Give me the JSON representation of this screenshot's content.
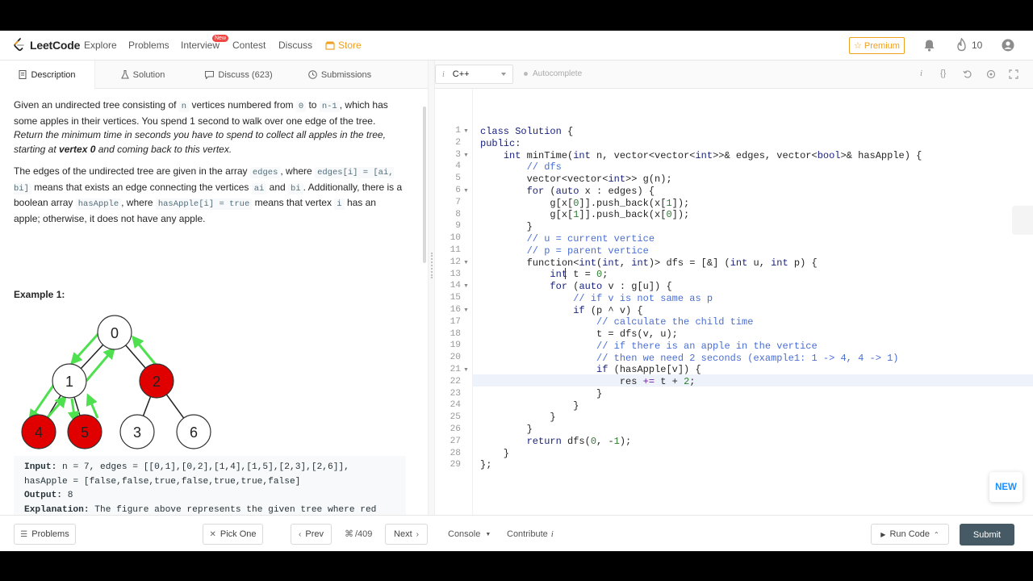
{
  "nav": {
    "logo": "LeetCode",
    "items": [
      "Explore",
      "Problems",
      "Interview",
      "Contest",
      "Discuss",
      "Store"
    ],
    "interview_badge": "New",
    "premium": "Premium",
    "fire_count": "10"
  },
  "tabs": {
    "description": "Description",
    "solution": "Solution",
    "discuss": "Discuss (623)",
    "submissions": "Submissions"
  },
  "description": {
    "p1_a": "Given an undirected tree consisting of ",
    "p1_n": "n",
    "p1_b": " vertices numbered from ",
    "p1_zero": "0",
    "p1_to": " to ",
    "p1_n1": "n-1",
    "p1_c": ", which has some apples in their vertices. You spend 1 second to walk over one edge of the tree. ",
    "p1_italic_a": "Return the minimum time in seconds you have to spend to collect all apples in the tree, starting at ",
    "p1_bold": "vertex 0",
    "p1_italic_b": " and coming back to this vertex.",
    "p2_a": "The edges of the undirected tree are given in the array ",
    "p2_edges": "edges",
    "p2_b": ", where ",
    "p2_edgesi": "edges[i] = [ai, bi]",
    "p2_c": " means that exists an edge connecting the vertices ",
    "p2_ai": "ai",
    "p2_and": " and ",
    "p2_bi": "bi",
    "p2_d": ". Additionally, there is a boolean array ",
    "p2_hasApple": "hasApple",
    "p2_e": ", where ",
    "p2_hasAppleTrue": "hasApple[i] = true",
    "p2_f": " means that vertex ",
    "p2_i": "i",
    "p2_g": " has an apple; otherwise, it does not have any apple.",
    "example_title": "Example 1:",
    "tree_labels": [
      "0",
      "1",
      "2",
      "4",
      "5",
      "3",
      "6"
    ],
    "input_label": "Input:",
    "input_text": " n = 7, edges = [[0,1],[0,2],[1,4],[1,5],[2,3],[2,6]], hasApple = [false,false,true,false,true,true,false]",
    "output_label": "Output:",
    "output_text": " 8",
    "explanation_label": "Explanation:",
    "explanation_text": " The figure above represents the given tree where red vertices have an apple. One optimal path to collect all apples is shown by the green arrows."
  },
  "editor": {
    "language": "C++",
    "autocomplete": "Autocomplete",
    "line_numbers": [
      "1",
      "2",
      "3",
      "4",
      "5",
      "6",
      "7",
      "8",
      "9",
      "10",
      "11",
      "12",
      "13",
      "14",
      "15",
      "16",
      "17",
      "18",
      "19",
      "20",
      "21",
      "22",
      "23",
      "24",
      "25",
      "26",
      "27",
      "28",
      "29"
    ],
    "fab": "NEW"
  },
  "bottom": {
    "problems": "Problems",
    "pick_one": "Pick One",
    "prev": "Prev",
    "page": "/409",
    "next": "Next",
    "console": "Console",
    "contribute": "Contribute",
    "run_code": "Run Code",
    "submit": "Submit"
  },
  "colors": {
    "apple": "#e00000",
    "arrow": "#4ee04e",
    "submit": "#455a64",
    "store": "#f0a020"
  }
}
